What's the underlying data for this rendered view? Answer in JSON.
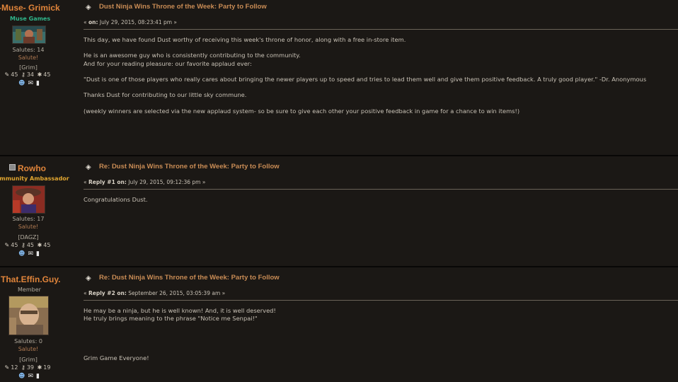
{
  "posts": [
    {
      "author": "-Muse- Grimick",
      "rank": "Muse Games",
      "rank_color": "#2fb58a",
      "salutes": "Salutes: 14",
      "salute_link": "Salute!",
      "clan": "[Grim]",
      "counts": [
        "45",
        "34",
        "45"
      ],
      "subject": "Dust Ninja Wins Throne of the Week: Party to Follow",
      "meta_prefix": "«",
      "meta_label": "on:",
      "meta_date": "July 29, 2015, 08:23:41 pm »",
      "body": [
        "This day, we have found Dust worthy of receiving this week's throne of honor, along with a free in-store item.",
        "",
        "He is an awesome guy who is consistently contributing to the community.",
        "And for your reading pleasure: our favorite applaud ever:",
        "",
        "\"Dust is one of those players who really cares about bringing the newer players up to speed and tries to lead them well and give them positive feedback. A truly good player.\" -Dr. Anonymous",
        "",
        "Thanks Dust for contributing to our little sky commune.",
        "",
        "(weekly winners are selected via the new applaud system- so be sure to give each other your positive feedback in game for a chance to win items!)"
      ]
    },
    {
      "author": "Rowho",
      "rank": "Community Ambassador",
      "rank_color": "#e0a530",
      "salutes": "Salutes: 17",
      "salute_link": "Salute!",
      "clan": "[DAGZ]",
      "counts": [
        "45",
        "45",
        "45"
      ],
      "subject": "Re: Dust Ninja Wins Throne of the Week: Party to Follow",
      "meta_prefix": "«",
      "meta_label": "Reply #1 on:",
      "meta_date": "July 29, 2015, 09:12:36 pm »",
      "body": [
        "Congratulations Dust."
      ]
    },
    {
      "author": "That.Effin.Guy.",
      "rank": "Member",
      "rank_color": "#b1aa9d",
      "salutes": "Salutes: 0",
      "salute_link": "Salute!",
      "clan": "[Grim]",
      "counts": [
        "12",
        "39",
        "19"
      ],
      "subject": "Re: Dust Ninja Wins Throne of the Week: Party to Follow",
      "meta_prefix": "«",
      "meta_label": "Reply #2 on:",
      "meta_date": "September 26, 2015, 03:05:39 am »",
      "body": [
        "He may be a ninja, but he is well known! And, it is well deserved!",
        "He truly brings meaning to the phrase \"Notice me Senpai!\"",
        "",
        "",
        "",
        "",
        "Grim Game Everyone!"
      ]
    }
  ],
  "icons": {
    "post": "message-icon",
    "stat1": "pencil-icon",
    "stat2": "key-icon",
    "stat3": "star-icon",
    "contact1": "profile-icon",
    "contact2": "email-icon",
    "contact3": "pm-icon"
  }
}
